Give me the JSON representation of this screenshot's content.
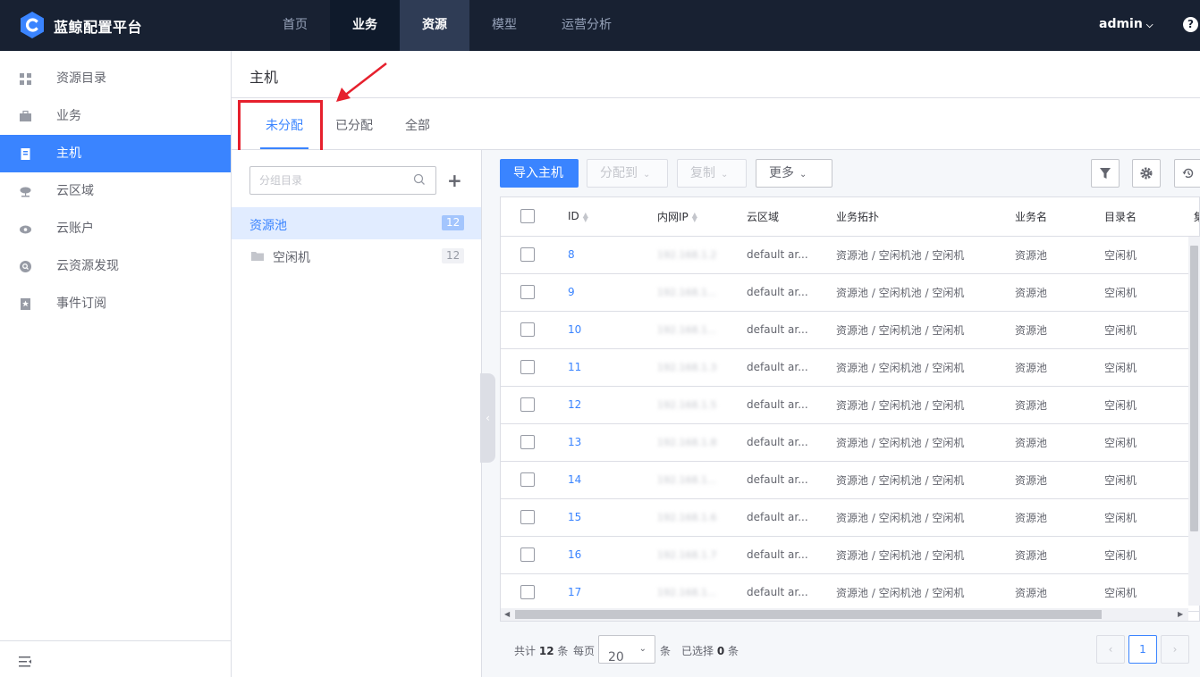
{
  "app": {
    "brand": "蓝鲸配置平台",
    "nav": [
      "首页",
      "业务",
      "资源",
      "模型",
      "运营分析"
    ],
    "user": "admin",
    "help": "?"
  },
  "sidebar": {
    "items": [
      {
        "label": "资源目录",
        "icon": "directory-icon"
      },
      {
        "label": "业务",
        "icon": "briefcase-icon"
      },
      {
        "label": "主机",
        "icon": "host-icon"
      },
      {
        "label": "云区域",
        "icon": "cloud-area-icon"
      },
      {
        "label": "云账户",
        "icon": "cloud-account-icon"
      },
      {
        "label": "云资源发现",
        "icon": "cloud-discovery-icon"
      },
      {
        "label": "事件订阅",
        "icon": "subscribe-icon"
      }
    ],
    "active": "主机"
  },
  "page": {
    "title": "主机",
    "tabs": [
      "未分配",
      "已分配",
      "全部"
    ],
    "active_tab": "未分配"
  },
  "group": {
    "search_placeholder": "分组目录",
    "add": "+",
    "root": {
      "label": "资源池",
      "count": "12"
    },
    "child": {
      "label": "空闲机",
      "count": "12"
    }
  },
  "toolbar": {
    "import": "导入主机",
    "assign": "分配到",
    "copy": "复制",
    "more": "更多"
  },
  "table": {
    "columns": [
      "ID",
      "内网IP",
      "云区域",
      "业务拓扑",
      "业务名",
      "目录名",
      "集"
    ],
    "rows": [
      {
        "id": "8",
        "ip": "192.168.1.2",
        "cloud": "default ar...",
        "topo": "资源池 / 空闲机池 / 空闲机",
        "biz": "资源池",
        "dir": "空闲机"
      },
      {
        "id": "9",
        "ip": "192.168.1...",
        "cloud": "default ar...",
        "topo": "资源池 / 空闲机池 / 空闲机",
        "biz": "资源池",
        "dir": "空闲机"
      },
      {
        "id": "10",
        "ip": "192.168.1...",
        "cloud": "default ar...",
        "topo": "资源池 / 空闲机池 / 空闲机",
        "biz": "资源池",
        "dir": "空闲机"
      },
      {
        "id": "11",
        "ip": "192.168.1.3",
        "cloud": "default ar...",
        "topo": "资源池 / 空闲机池 / 空闲机",
        "biz": "资源池",
        "dir": "空闲机"
      },
      {
        "id": "12",
        "ip": "192.168.1.5",
        "cloud": "default ar...",
        "topo": "资源池 / 空闲机池 / 空闲机",
        "biz": "资源池",
        "dir": "空闲机"
      },
      {
        "id": "13",
        "ip": "192.168.1.8",
        "cloud": "default ar...",
        "topo": "资源池 / 空闲机池 / 空闲机",
        "biz": "资源池",
        "dir": "空闲机"
      },
      {
        "id": "14",
        "ip": "192.168.1...",
        "cloud": "default ar...",
        "topo": "资源池 / 空闲机池 / 空闲机",
        "biz": "资源池",
        "dir": "空闲机"
      },
      {
        "id": "15",
        "ip": "192.168.1.6",
        "cloud": "default ar...",
        "topo": "资源池 / 空闲机池 / 空闲机",
        "biz": "资源池",
        "dir": "空闲机"
      },
      {
        "id": "16",
        "ip": "192.168.1.7",
        "cloud": "default ar...",
        "topo": "资源池 / 空闲机池 / 空闲机",
        "biz": "资源池",
        "dir": "空闲机"
      },
      {
        "id": "17",
        "ip": "192.168.1...",
        "cloud": "default ar...",
        "topo": "资源池 / 空闲机池 / 空闲机",
        "biz": "资源池",
        "dir": "空闲机"
      }
    ]
  },
  "pagination": {
    "total_prefix": "共计",
    "total": "12",
    "total_suffix": "条",
    "per_page_label": "每页",
    "per_page": "20",
    "per_page_suffix": "条",
    "selected_prefix": "已选择",
    "selected": "0",
    "selected_suffix": "条",
    "current": "1"
  },
  "colors": {
    "topbar": "#182132",
    "accent": "#3a84ff",
    "annotation": "#e6202d"
  }
}
